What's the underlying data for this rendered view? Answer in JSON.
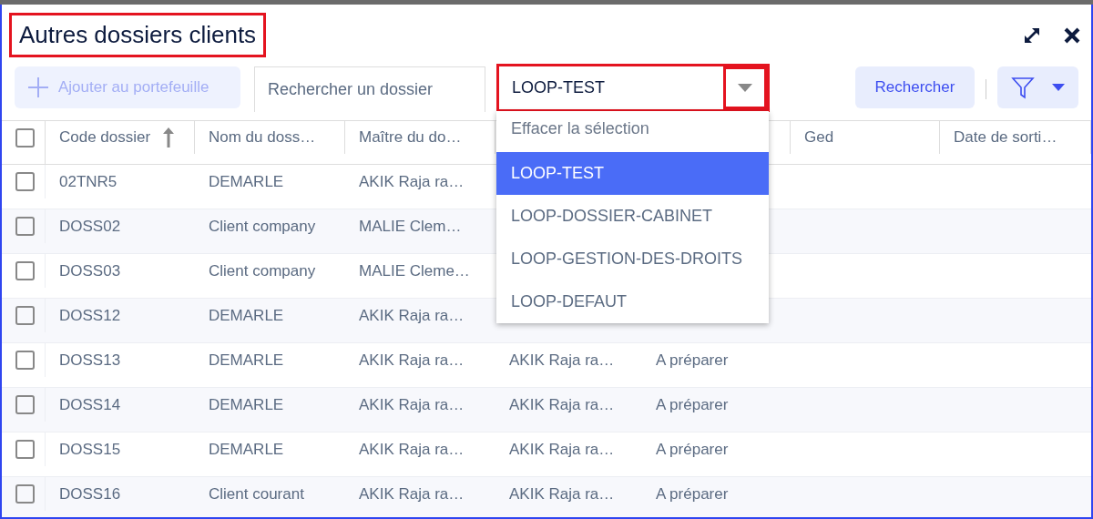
{
  "window": {
    "title": "Autres dossiers clients",
    "title_highlighted": true
  },
  "toolbar": {
    "add_button": {
      "label": "Ajouter au portefeuille",
      "disabled": true
    },
    "search": {
      "placeholder": "Rechercher un dossier"
    },
    "select": {
      "value": "LOOP-TEST",
      "highlighted": true,
      "expanded": true
    },
    "search_button": {
      "label": "Rechercher"
    }
  },
  "dropdown": [
    {
      "label": "Effacer la sélection",
      "kind": "clear",
      "selected": false
    },
    {
      "label": "LOOP-TEST",
      "kind": "option",
      "selected": true
    },
    {
      "label": "LOOP-DOSSIER-CABINET",
      "kind": "option",
      "selected": false
    },
    {
      "label": "LOOP-GESTION-DES-DROITS",
      "kind": "option",
      "selected": false
    },
    {
      "label": "LOOP-DEFAUT",
      "kind": "option",
      "selected": false
    }
  ],
  "table": {
    "select_all_checked": false,
    "columns": [
      {
        "label": "Code dossier",
        "sorted": true
      },
      {
        "label": "Nom du doss…"
      },
      {
        "label": "Maître du do…"
      },
      {},
      {},
      {
        "label": "Ged"
      },
      {
        "label": "Date de sorti…"
      }
    ],
    "rows": [
      {
        "checked": false,
        "cells": [
          "02TNR5",
          "DEMARLE",
          "AKIK Raja ra…",
          null,
          null,
          null,
          null
        ]
      },
      {
        "checked": false,
        "cells": [
          "DOSS02",
          "Client company",
          "MALIE Clem…",
          null,
          null,
          null,
          null
        ]
      },
      {
        "checked": false,
        "cells": [
          "DOSS03",
          "Client company",
          "MALIE Cleme…",
          null,
          null,
          null,
          null
        ]
      },
      {
        "checked": false,
        "cells": [
          "DOSS12",
          "DEMARLE",
          "AKIK Raja ra…",
          null,
          null,
          null,
          null
        ]
      },
      {
        "checked": false,
        "cells": [
          "DOSS13",
          "DEMARLE",
          "AKIK Raja ra…",
          "AKIK Raja ra…",
          "A préparer",
          null,
          null
        ]
      },
      {
        "checked": false,
        "cells": [
          "DOSS14",
          "DEMARLE",
          "AKIK Raja ra…",
          "AKIK Raja ra…",
          "A préparer",
          null,
          null
        ]
      },
      {
        "checked": false,
        "cells": [
          "DOSS15",
          "DEMARLE",
          "AKIK Raja ra…",
          "AKIK Raja ra…",
          "A préparer",
          null,
          null
        ]
      },
      {
        "checked": false,
        "cells": [
          "DOSS16",
          "Client courant",
          "AKIK Raja ra…",
          "AKIK Raja ra…",
          "A préparer",
          null,
          null
        ]
      }
    ]
  }
}
